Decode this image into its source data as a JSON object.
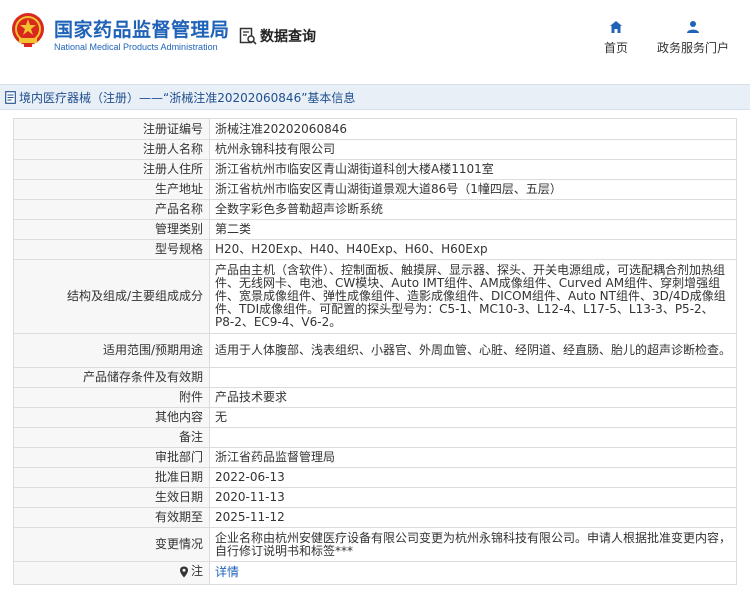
{
  "header": {
    "brand_cn": "国家药品监督管理局",
    "brand_en": "National Medical Products Administration",
    "search_label": "数据查询",
    "nav": [
      {
        "label": "首页",
        "icon": "home-icon"
      },
      {
        "label": "政务服务门户",
        "icon": "user-icon"
      }
    ]
  },
  "breadcrumb": {
    "text": "境内医疗器械（注册）——“浙械注准20202060846”基本信息"
  },
  "table": {
    "rows": [
      {
        "label": "注册证编号",
        "value": "浙械注准20202060846"
      },
      {
        "label": "注册人名称",
        "value": "杭州永锦科技有限公司"
      },
      {
        "label": "注册人住所",
        "value": "浙江省杭州市临安区青山湖街道科创大楼A楼1101室"
      },
      {
        "label": "生产地址",
        "value": "浙江省杭州市临安区青山湖街道景观大道86号（1幢四层、五层）"
      },
      {
        "label": "产品名称",
        "value": "全数字彩色多普勒超声诊断系统"
      },
      {
        "label": "管理类别",
        "value": "第二类"
      },
      {
        "label": "型号规格",
        "value": "H20、H20Exp、H40、H40Exp、H60、H60Exp"
      },
      {
        "label": "结构及组成/主要组成成分",
        "value": "产品由主机（含软件）、控制面板、触摸屏、显示器、探头、开关电源组成，可选配耦合剂加热组件、无线网卡、电池、CW模块、Auto IMT组件、AM成像组件、Curved AM组件、穿刺增强组件、宽景成像组件、弹性成像组件、造影成像组件、DICOM组件、Auto NT组件、3D/4D成像组件、TDI成像组件。可配置的探头型号为：C5-1、MC10-3、L12-4、L17-5、L13-3、P5-2、P8-2、EC9-4、V6-2。"
      },
      {
        "label": "适用范围/预期用途",
        "value": "适用于人体腹部、浅表组织、小器官、外周血管、心脏、经阴道、经直肠、胎儿的超声诊断检查。"
      },
      {
        "label": "产品储存条件及有效期",
        "value": ""
      },
      {
        "label": "附件",
        "value": "产品技术要求"
      },
      {
        "label": "其他内容",
        "value": "无"
      },
      {
        "label": "备注",
        "value": ""
      },
      {
        "label": "审批部门",
        "value": "浙江省药品监督管理局"
      },
      {
        "label": "批准日期",
        "value": "2022-06-13"
      },
      {
        "label": "生效日期",
        "value": "2020-11-13"
      },
      {
        "label": "有效期至",
        "value": "2025-11-12"
      },
      {
        "label": "变更情况",
        "value": "企业名称由杭州安健医疗设备有限公司变更为杭州永锦科技有限公司。申请人根据批准变更内容，自行修订说明书和标签***"
      },
      {
        "label": "注",
        "value": "详情"
      }
    ]
  },
  "colors": {
    "brand_blue": "#1f63b8",
    "emblem_red": "#d9281e",
    "emblem_gold": "#f2c230",
    "label_bg": "#f7f7f7",
    "crumb_bg": "#e9eff6"
  }
}
